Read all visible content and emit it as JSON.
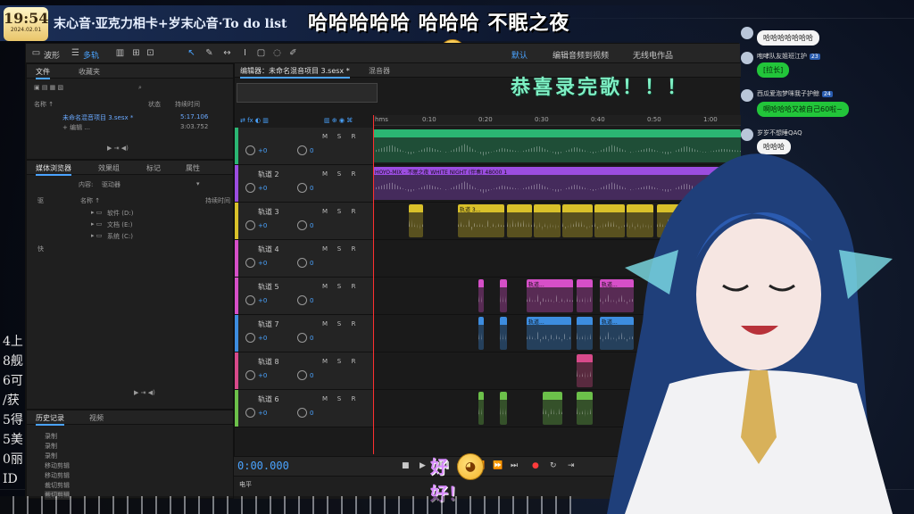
{
  "overlay": {
    "clock_time": "19:54",
    "clock_date": "2024.02.01",
    "stream_title": "末心音·亚克力相卡+岁末心音·To do list",
    "laugh_caption": "哈哈哈哈哈 哈哈哈 不眠之夜",
    "congrats_caption": "恭喜录完歌！！！",
    "hao_line1": "好",
    "hao_line2": "好！",
    "side_stats": [
      "4上",
      "8舰",
      "6可",
      "/获",
      "5得",
      "5美",
      "0丽",
      "ID"
    ]
  },
  "toolbar": {
    "waveform_label": "波形",
    "multitrack_label": "多轨",
    "default_label": "默认",
    "edit_audio_video_label": "编辑音频到视频",
    "wireless_label": "无线电作品"
  },
  "left_panel": {
    "tab_files": "文件",
    "tab_favorites": "收藏夹",
    "col_name": "名称 ↑",
    "col_status": "状态",
    "col_duration": "持续时间",
    "file_name": "未命名混音项目 3.sesx *",
    "file_duration": "5:17.106",
    "file2_name": "+ 编辑 ...",
    "file2_duration": "3:03.752"
  },
  "media_panel": {
    "tab_media": "媒体浏览器",
    "tab_effects": "效果组",
    "tab_markers": "标记",
    "tab_properties": "属性",
    "content_label": "内容:",
    "content_value": "驱动器",
    "col_name": "名称 ↑",
    "col_duration": "持续时间",
    "tree_root": "驱",
    "tree_shortcut": "快",
    "drive1": "软件 (D:)",
    "drive2": "文档 (E:)",
    "drive3": "系统 (C:)"
  },
  "history_panel": {
    "tab_history": "历史记录",
    "tab_video": "视频",
    "items": [
      "录制",
      "录制",
      "录制",
      "移动剪辑",
      "移动剪辑",
      "裁切剪辑",
      "裁切剪辑"
    ]
  },
  "editor": {
    "tab_label": "编辑器：未命名混音项目 3.sesx *",
    "tab_mixer": "混音器",
    "ruler_labels": [
      "hms",
      "0:10",
      "0:20",
      "0:30",
      "0:40",
      "0:50",
      "1:00"
    ],
    "long_clip_title": "HOYO-MIX - 不眠之夜 WHITE NIGHT (伴奏) 48000 1",
    "tracks": [
      {
        "name": "",
        "vol": "+0",
        "pan": "0"
      },
      {
        "name": "轨道 2",
        "vol": "+0",
        "pan": "0"
      },
      {
        "name": "轨道 3",
        "vol": "+0",
        "pan": "0"
      },
      {
        "name": "轨道 4",
        "vol": "+0",
        "pan": "0"
      },
      {
        "name": "轨道 5",
        "vol": "+0",
        "pan": "0"
      },
      {
        "name": "轨道 7",
        "vol": "+0",
        "pan": "0"
      },
      {
        "name": "轨道 8",
        "vol": "+0",
        "pan": "0"
      },
      {
        "name": "轨道 6",
        "vol": "+0",
        "pan": "0"
      }
    ],
    "btn_m": "M",
    "btn_s": "S",
    "btn_r": "R",
    "clip_label_3": "轨道 3...",
    "clip_label_5": "轨道...",
    "clip_label_7": "轨道..."
  },
  "transport": {
    "time": "0:00.000",
    "level_label": "电平"
  },
  "chat": {
    "messages": [
      {
        "user": "",
        "text": "哈哈哈哈哈哈哈",
        "style": "white"
      },
      {
        "user": "咆哮队友姐班江护",
        "badge": "23",
        "text": "[拉长]",
        "style": "green"
      },
      {
        "user": "西瓜爱泡梦咪我子护鲸",
        "badge": "24",
        "text": "啊哈哈哈又被自己60啦~",
        "style": "green"
      },
      {
        "user": "岁岁不想睡QAQ",
        "text": "哈哈哈",
        "style": "white"
      }
    ]
  },
  "colors": {
    "accent": "#4aa3ff",
    "track_green": "#2bb673",
    "track_purple": "#9b4de0",
    "track_yellow": "#d9c12a",
    "track_magenta": "#d64fc8",
    "track_blue": "#3d8de0",
    "track_pink": "#d84a8a",
    "track_lime": "#6cc04a"
  }
}
